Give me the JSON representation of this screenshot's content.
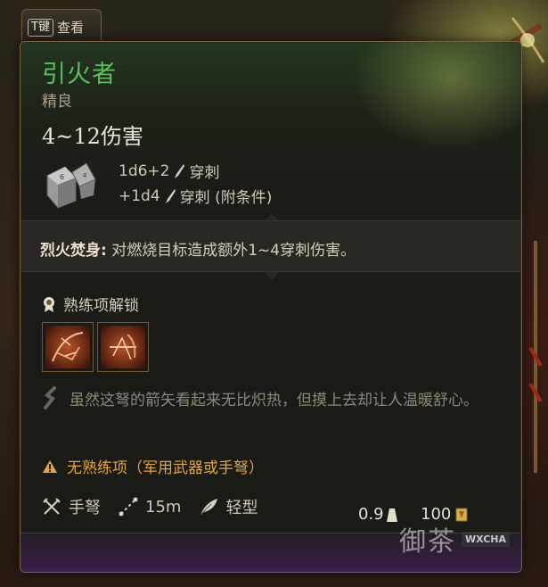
{
  "view_tab": {
    "key": "T键",
    "label": "查看"
  },
  "item": {
    "name": "引火者",
    "rarity": "精良",
    "damage_total": "4~12伤害",
    "damage_lines": [
      {
        "dice": "1d6+2",
        "type": "穿刺"
      },
      {
        "dice": "+1d4",
        "type": "穿刺 (附条件)"
      }
    ],
    "effect": {
      "name": "烈火焚身:",
      "description": " 对燃烧目标造成额外1~4穿刺伤害。"
    },
    "proficiency_title": "熟练项解锁",
    "flavor": "虽然这弩的箭矢看起来无比炽热，但摸上去却让人温暖舒心。",
    "warning": "无熟练项（军用武器或手弩）",
    "properties": [
      {
        "icon": "crossed-weapons-icon",
        "label": "手弩"
      },
      {
        "icon": "range-icon",
        "label": "15m"
      },
      {
        "icon": "feather-icon",
        "label": "轻型"
      }
    ],
    "weight": "0.9",
    "price": "100"
  },
  "watermark": {
    "text": "御茶",
    "badge": "WXCHA"
  },
  "colors": {
    "name_green": "#56c25a",
    "warning_orange": "#e2a640",
    "flavor_gray": "#8f8878"
  }
}
